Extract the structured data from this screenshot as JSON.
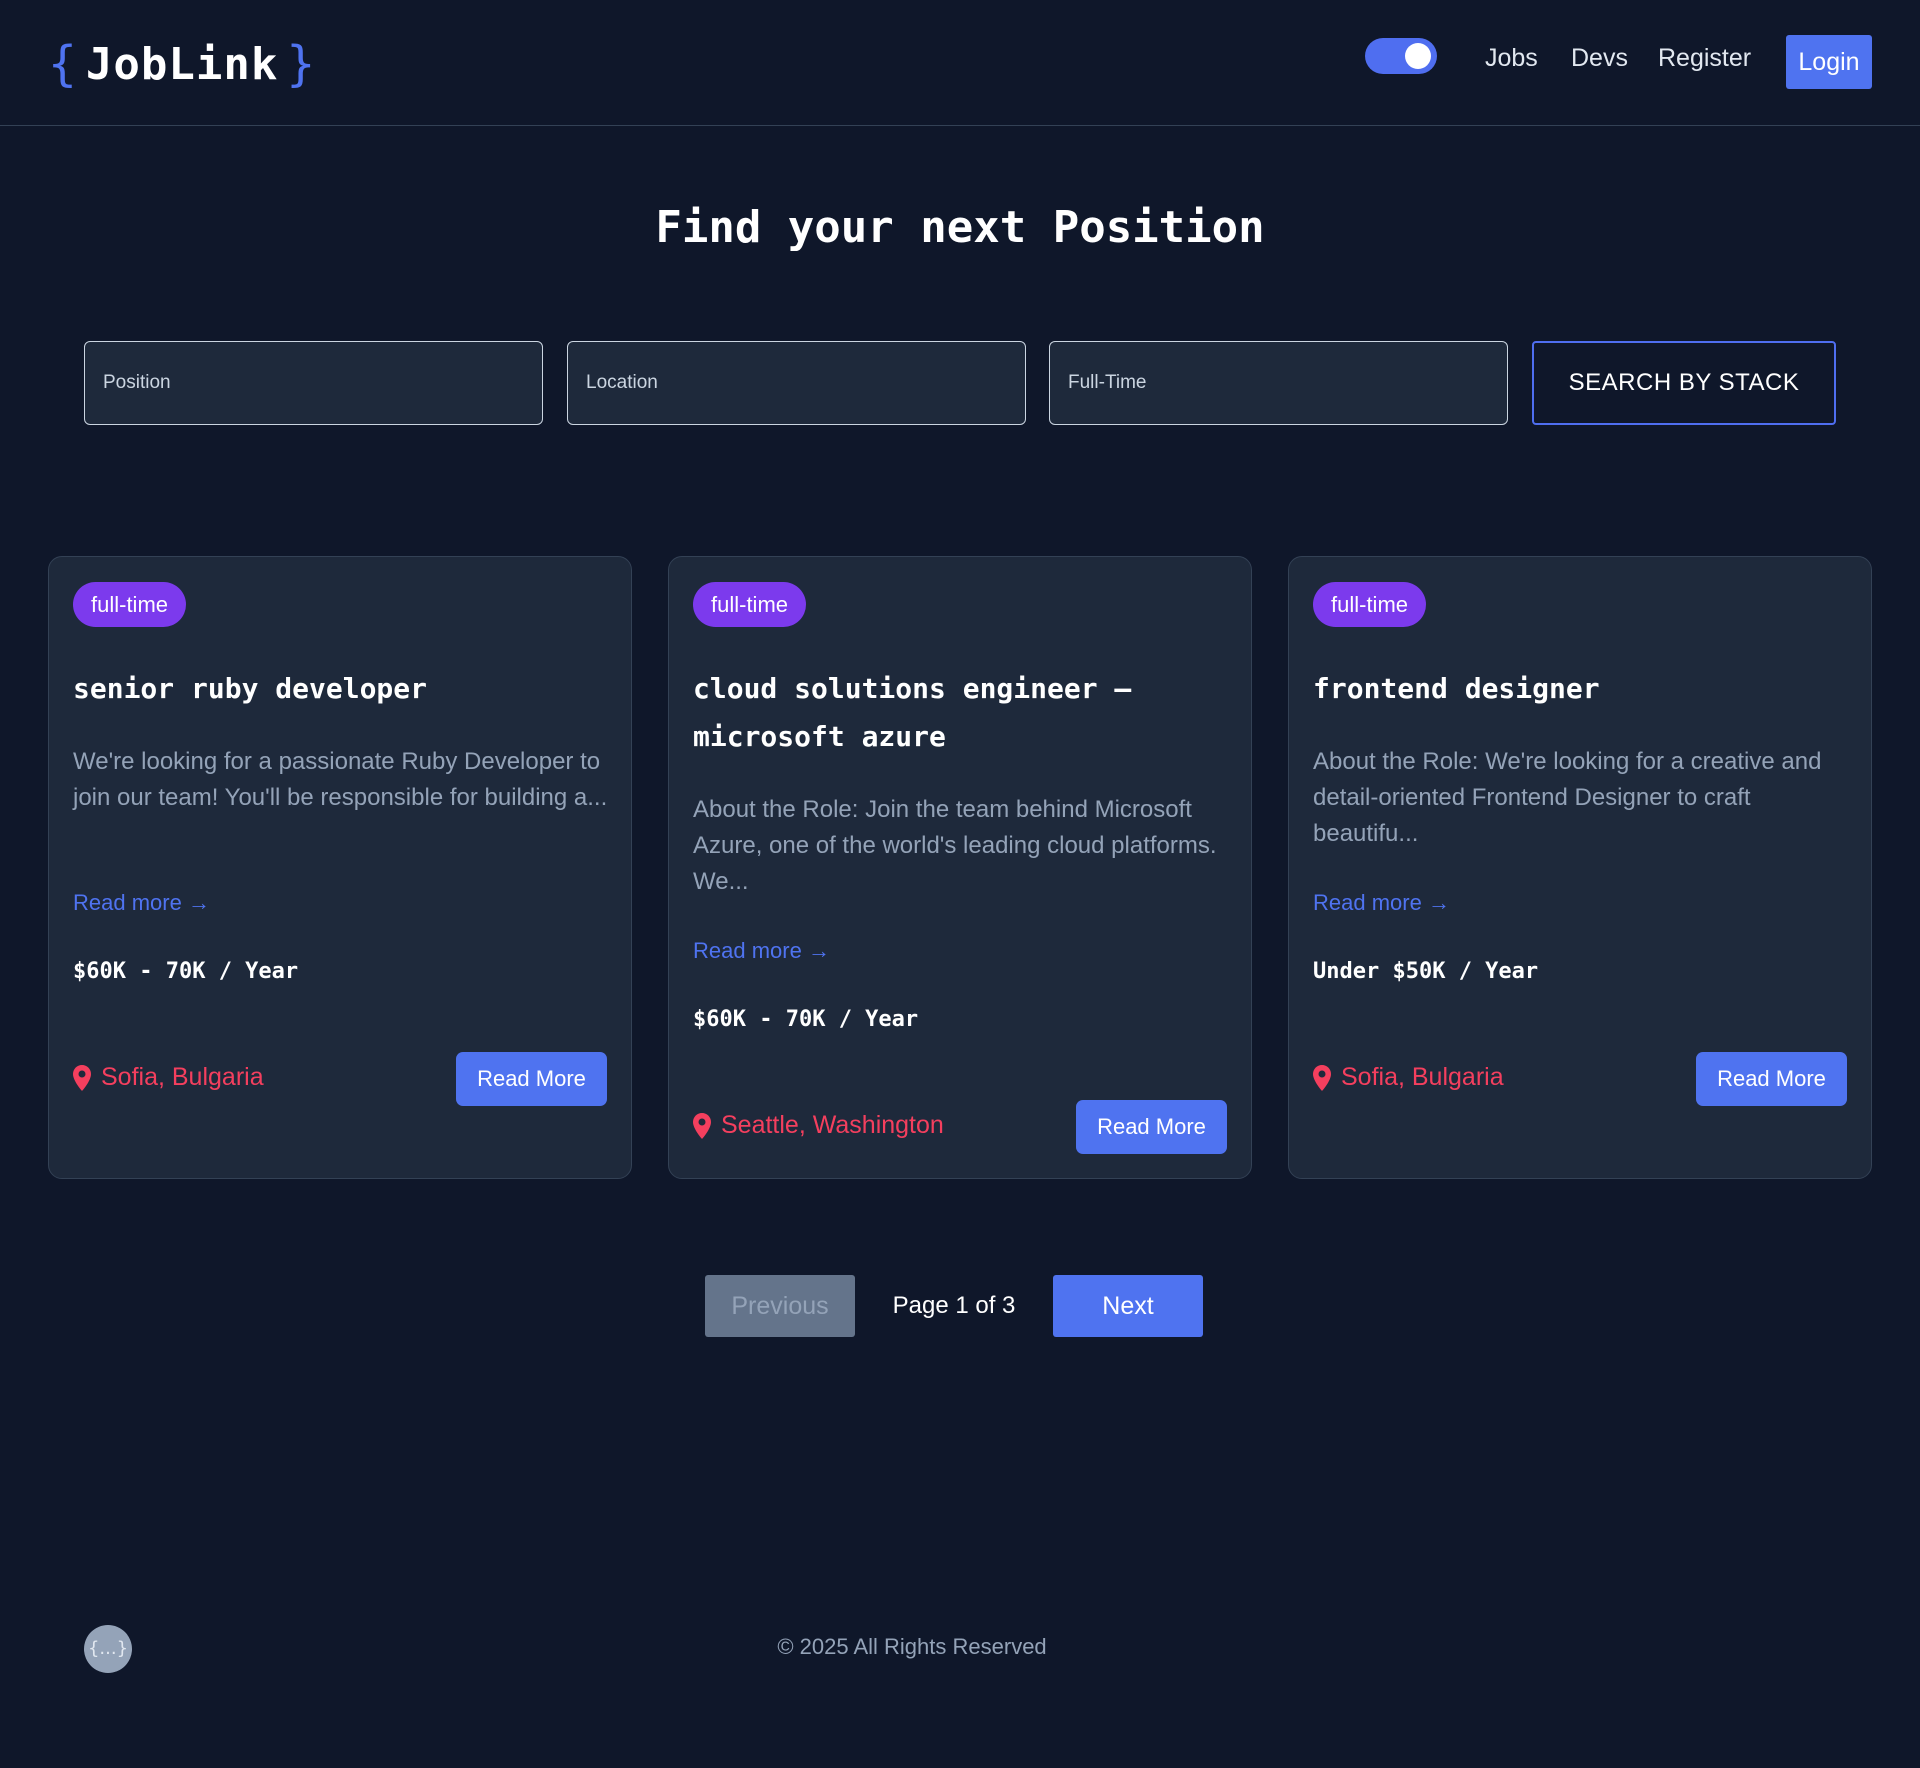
{
  "header": {
    "logo": {
      "open_brace": "{",
      "name": "JobLink",
      "close_brace": "}"
    },
    "theme_toggle": {
      "state": "on"
    },
    "nav": {
      "jobs": "Jobs",
      "devs": "Devs",
      "register": "Register",
      "login": "Login"
    }
  },
  "hero": {
    "title": "Find your next Position"
  },
  "search": {
    "position_placeholder": "Position",
    "location_placeholder": "Location",
    "type_placeholder": "Full-Time",
    "stack_button": "SEARCH BY STACK"
  },
  "jobs": [
    {
      "badge": "full-time",
      "title": "senior ruby developer",
      "description": "We're looking for a passionate Ruby Developer to join our team! You'll be responsible for building a...",
      "read_more_link": "Read more →",
      "salary": "$60K - 70K / Year",
      "location": "Sofia, Bulgaria",
      "button": "Read More"
    },
    {
      "badge": "full-time",
      "title": "cloud solutions engineer – microsoft azure",
      "description": "About the Role: Join the team behind Microsoft Azure, one of the world's leading cloud platforms. We...",
      "read_more_link": "Read more →",
      "salary": "$60K - 70K / Year",
      "location": "Seattle, Washington",
      "button": "Read More"
    },
    {
      "badge": "full-time",
      "title": "frontend designer",
      "description": "About the Role: We're looking for a creative and detail-oriented Frontend Designer to craft beautifu...",
      "read_more_link": "Read more →",
      "salary": "Under $50K / Year",
      "location": "Sofia, Bulgaria",
      "button": "Read More"
    }
  ],
  "pagination": {
    "previous": "Previous",
    "info": "Page 1 of 3",
    "next": "Next"
  },
  "footer": {
    "icon_text": "{...}",
    "copyright": "© 2025 All Rights Reserved"
  },
  "colors": {
    "background": "#0f172a",
    "card": "#1e293b",
    "accent": "#4f73f0",
    "badge": "#7c3aed",
    "location": "#f43f5e"
  },
  "icons": {
    "location": "map-pin-icon"
  }
}
